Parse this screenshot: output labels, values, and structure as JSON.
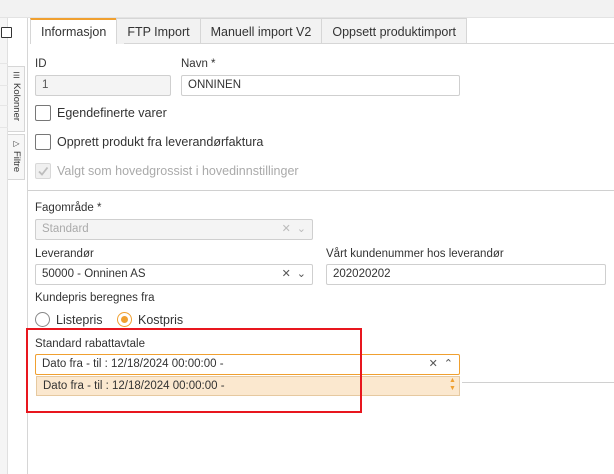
{
  "side": {
    "columns_label": "Kolonner",
    "filter_label": "Filtre",
    "columns_icon": "columns-icon",
    "filter_icon": "filter-icon"
  },
  "tabs": [
    {
      "label": "Informasjon",
      "active": true
    },
    {
      "label": "FTP Import",
      "active": false
    },
    {
      "label": "Manuell import V2",
      "active": false
    },
    {
      "label": "Oppsett produktimport",
      "active": false
    }
  ],
  "form": {
    "id_label": "ID",
    "id_value": "1",
    "name_label": "Navn *",
    "name_value": "ONNINEN",
    "custom_items_label": "Egendefinerte varer",
    "custom_items_checked": false,
    "create_product_label": "Opprett produkt fra leverandørfaktura",
    "create_product_checked": false,
    "main_wholesaler_label": "Valgt som hovedgrossist i hovedinnstillinger",
    "main_wholesaler_checked": true,
    "field_label": "Fagområde *",
    "field_value": "Standard",
    "supplier_label": "Leverandør",
    "supplier_value": "50000 - Onninen AS",
    "customer_number_label": "Vårt kundenummer hos leverandør",
    "customer_number_value": "202020202",
    "price_basis_label": "Kundepris beregnes fra",
    "list_price_label": "Listepris",
    "cost_price_label": "Kostpris",
    "selected_price_basis": "Kostpris",
    "discount_label": "Standard rabattavtale",
    "discount_value": "Dato fra - til : 12/18/2024 00:00:00 -",
    "discount_options": [
      "Dato fra - til : 12/18/2024 00:00:00 -"
    ]
  },
  "colors": {
    "accent": "#f0a030",
    "highlight_box": "#e8161e",
    "dropdown_option_bg": "#fbe8cf"
  }
}
